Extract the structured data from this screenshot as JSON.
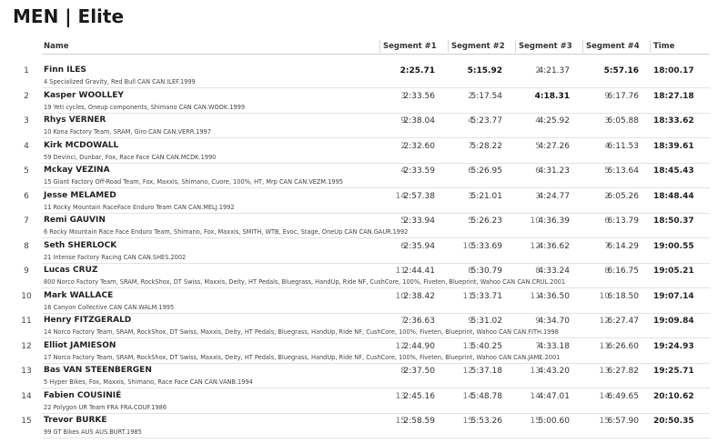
{
  "title": "MEN | Elite",
  "columns": {
    "name": "Name",
    "seg1": "Segment #1",
    "seg2": "Segment #2",
    "seg3": "Segment #3",
    "seg4": "Segment #4",
    "time": "Time"
  },
  "results": [
    {
      "rank": "1",
      "name": "Finn ILES",
      "details": "4   Specialized Gravity, Red Bull   CAN   CAN.ILEF.1999",
      "segments": [
        {
          "rank": "",
          "time": "2:25.71",
          "best": true
        },
        {
          "rank": "",
          "time": "5:15.92",
          "best": true
        },
        {
          "rank": "2",
          "time": "4:21.37",
          "best": false
        },
        {
          "rank": "",
          "time": "5:57.16",
          "best": true
        }
      ],
      "time": "18:00.17"
    },
    {
      "rank": "2",
      "name": "Kasper WOOLLEY",
      "details": "19   Yeti cycles, Oneup components, Shimano   CAN   CAN.WOOK.1999",
      "segments": [
        {
          "rank": "3",
          "time": "2:33.56",
          "best": false
        },
        {
          "rank": "2",
          "time": "5:17.54",
          "best": false
        },
        {
          "rank": "",
          "time": "4:18.31",
          "best": true
        },
        {
          "rank": "9",
          "time": "6:17.76",
          "best": false
        }
      ],
      "time": "18:27.18"
    },
    {
      "rank": "3",
      "name": "Rhys VERNER",
      "details": "10   Kona Factory Team, SRAM, Giro   CAN   CAN.VERR.1997",
      "segments": [
        {
          "rank": "9",
          "time": "2:38.04",
          "best": false
        },
        {
          "rank": "4",
          "time": "5:23.77",
          "best": false
        },
        {
          "rank": "4",
          "time": "4:25.92",
          "best": false
        },
        {
          "rank": "3",
          "time": "6:05.88",
          "best": false
        }
      ],
      "time": "18:33.62"
    },
    {
      "rank": "4",
      "name": "Kirk MCDOWALL",
      "details": "59   Devinci, Dunbar, Fox, Race Face   CAN   CAN.MCDK.1990",
      "segments": [
        {
          "rank": "2",
          "time": "2:32.60",
          "best": false
        },
        {
          "rank": "7",
          "time": "5:28.22",
          "best": false
        },
        {
          "rank": "5",
          "time": "4:27.26",
          "best": false
        },
        {
          "rank": "4",
          "time": "6:11.53",
          "best": false
        }
      ],
      "time": "18:39.61"
    },
    {
      "rank": "5",
      "name": "Mckay VEZINA",
      "details": "15   Giant Factory Off-Road Team, Fox, Maxxis, Shimano, Cuore, 100%, HT, Mrp   CAN   CAN.VEZM.1995",
      "segments": [
        {
          "rank": "4",
          "time": "2:33.59",
          "best": false
        },
        {
          "rank": "6",
          "time": "5:26.95",
          "best": false
        },
        {
          "rank": "6",
          "time": "4:31.23",
          "best": false
        },
        {
          "rank": "5",
          "time": "6:13.64",
          "best": false
        }
      ],
      "time": "18:45.43"
    },
    {
      "rank": "6",
      "name": "Jesse MELAMED",
      "details": "11   Rocky Mountain RaceFace Enduro Team   CAN   CAN.MELJ.1992",
      "segments": [
        {
          "rank": "14",
          "time": "2:57.38",
          "best": false
        },
        {
          "rank": "3",
          "time": "5:21.01",
          "best": false
        },
        {
          "rank": "3",
          "time": "4:24.77",
          "best": false
        },
        {
          "rank": "2",
          "time": "6:05.26",
          "best": false
        }
      ],
      "time": "18:48.44"
    },
    {
      "rank": "7",
      "name": "Remi GAUVIN",
      "details": "6   Rocky Mountain Race Face Enduro Team, Shimano, Fox, Maxxis, SMITH, WTB, Evoc, Stage, OneUp   CAN   CAN.GAUR.1992",
      "segments": [
        {
          "rank": "5",
          "time": "2:33.94",
          "best": false
        },
        {
          "rank": "5",
          "time": "5:26.23",
          "best": false
        },
        {
          "rank": "10",
          "time": "4:36.39",
          "best": false
        },
        {
          "rank": "6",
          "time": "6:13.79",
          "best": false
        }
      ],
      "time": "18:50.37"
    },
    {
      "rank": "8",
      "name": "Seth SHERLOCK",
      "details": "21   Intense Factory Racing   CAN   CAN.SHES.2002",
      "segments": [
        {
          "rank": "6",
          "time": "2:35.94",
          "best": false
        },
        {
          "rank": "10",
          "time": "5:33.69",
          "best": false
        },
        {
          "rank": "12",
          "time": "4:36.62",
          "best": false
        },
        {
          "rank": "7",
          "time": "6:14.29",
          "best": false
        }
      ],
      "time": "19:00.55"
    },
    {
      "rank": "9",
      "name": "Lucas CRUZ",
      "details": "800   Norco Factory Team, SRAM, RockShox, DT Swiss, Maxxis, Deity, HT Pedals, Bluegrass, HandUp, Ride NF, CushCore, 100%, Fiveten, Blueprint, Wahoo   CAN   CAN.CRUL.2001",
      "segments": [
        {
          "rank": "11",
          "time": "2:44.41",
          "best": false
        },
        {
          "rank": "8",
          "time": "5:30.79",
          "best": false
        },
        {
          "rank": "8",
          "time": "4:33.24",
          "best": false
        },
        {
          "rank": "8",
          "time": "6:16.75",
          "best": false
        }
      ],
      "time": "19:05.21"
    },
    {
      "rank": "10",
      "name": "Mark WALLACE",
      "details": "16   Canyon Collective   CAN   CAN.WALM.1995",
      "segments": [
        {
          "rank": "10",
          "time": "2:38.42",
          "best": false
        },
        {
          "rank": "11",
          "time": "5:33.71",
          "best": false
        },
        {
          "rank": "11",
          "time": "4:36.50",
          "best": false
        },
        {
          "rank": "10",
          "time": "6:18.50",
          "best": false
        }
      ],
      "time": "19:07.14"
    },
    {
      "rank": "11",
      "name": "Henry FITZGERALD",
      "details": "14   Norco Factory Team, SRAM, RockShox, DT Swiss, Maxxis, Deity, HT Pedals, Bluegrass, HandUp, Ride NF, CushCore, 100%, Fiveten, Blueprint, Wahoo   CAN   CAN.FITH.1998",
      "segments": [
        {
          "rank": "7",
          "time": "2:36.63",
          "best": false
        },
        {
          "rank": "9",
          "time": "5:31.02",
          "best": false
        },
        {
          "rank": "9",
          "time": "4:34.70",
          "best": false
        },
        {
          "rank": "12",
          "time": "6:27.47",
          "best": false
        }
      ],
      "time": "19:09.84"
    },
    {
      "rank": "12",
      "name": "Elliot JAMIESON",
      "details": "17   Norco Factory Team, SRAM, RockShox, DT Swiss, Maxxis, Deity, HT Pedals, Bluegrass, HandUp, Ride NF, CushCore, 100%, Fiveten, Blueprint, Wahoo   CAN   CAN.JAME.2001",
      "segments": [
        {
          "rank": "12",
          "time": "2:44.90",
          "best": false
        },
        {
          "rank": "13",
          "time": "5:40.25",
          "best": false
        },
        {
          "rank": "7",
          "time": "4:33.18",
          "best": false
        },
        {
          "rank": "11",
          "time": "6:26.60",
          "best": false
        }
      ],
      "time": "19:24.93"
    },
    {
      "rank": "13",
      "name": "Bas VAN STEENBERGEN",
      "details": "5   Hyper Bikes, Fox, Maxxis, Shimano, Race Face   CAN   CAN.VANB.1994",
      "segments": [
        {
          "rank": "8",
          "time": "2:37.50",
          "best": false
        },
        {
          "rank": "12",
          "time": "5:37.18",
          "best": false
        },
        {
          "rank": "13",
          "time": "4:43.20",
          "best": false
        },
        {
          "rank": "13",
          "time": "6:27.82",
          "best": false
        }
      ],
      "time": "19:25.71"
    },
    {
      "rank": "14",
      "name": "Fabien COUSINIÉ",
      "details": "22   Polygon UR Team   FRA   FRA.COUF.1986",
      "segments": [
        {
          "rank": "13",
          "time": "2:45.16",
          "best": false
        },
        {
          "rank": "14",
          "time": "5:48.78",
          "best": false
        },
        {
          "rank": "14",
          "time": "4:47.01",
          "best": false
        },
        {
          "rank": "14",
          "time": "6:49.65",
          "best": false
        }
      ],
      "time": "20:10.62"
    },
    {
      "rank": "15",
      "name": "Trevor BURKE",
      "details": "99   GT Bikes   AUS   AUS.BURT.1985",
      "segments": [
        {
          "rank": "15",
          "time": "2:58.59",
          "best": false
        },
        {
          "rank": "15",
          "time": "5:53.26",
          "best": false
        },
        {
          "rank": "15",
          "time": "5:00.60",
          "best": false
        },
        {
          "rank": "15",
          "time": "6:57.90",
          "best": false
        }
      ],
      "time": "20:50.35"
    }
  ]
}
